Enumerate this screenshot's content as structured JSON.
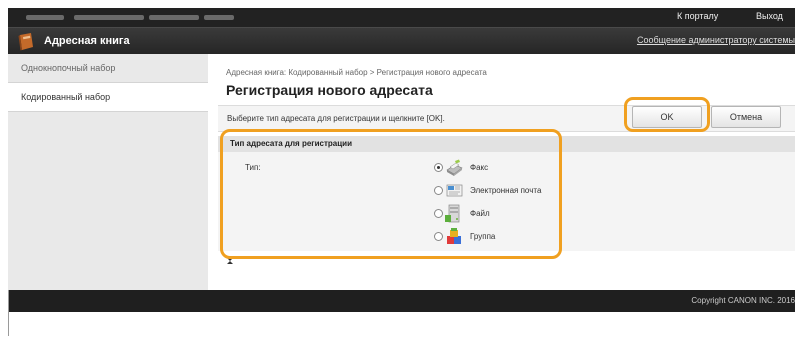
{
  "topbar": {
    "portal_link": "К порталу",
    "logout_link": "Выход"
  },
  "app": {
    "title": "Адресная книга",
    "admin_message_link": "Сообщение администратору системы",
    "icon": "address-book-icon"
  },
  "sidebar": {
    "items": [
      {
        "label": "Однокнопочный набор",
        "active": false
      },
      {
        "label": "Кодированный набор",
        "active": true
      }
    ]
  },
  "main": {
    "breadcrumb": "Адресная книга: Кодированный набор > Регистрация нового адресата",
    "title": "Регистрация нового адресата",
    "instruction": "Выберите тип адресата для регистрации и щелкните [OK].",
    "buttons": {
      "ok": "OK",
      "cancel": "Отмена"
    },
    "section": {
      "title": "Тип адресата для регистрации",
      "type_label": "Тип:",
      "options": [
        {
          "label": "Факс",
          "icon": "fax-icon",
          "checked": true
        },
        {
          "label": "Электронная почта",
          "icon": "email-icon",
          "checked": false
        },
        {
          "label": "Файл",
          "icon": "file-server-icon",
          "checked": false
        },
        {
          "label": "Группа",
          "icon": "group-icon",
          "checked": false
        }
      ]
    }
  },
  "footer": {
    "copyright": "Copyright CANON INC. 2016"
  },
  "colors": {
    "highlight": "#f0a020",
    "dark_bar": "#222222"
  }
}
